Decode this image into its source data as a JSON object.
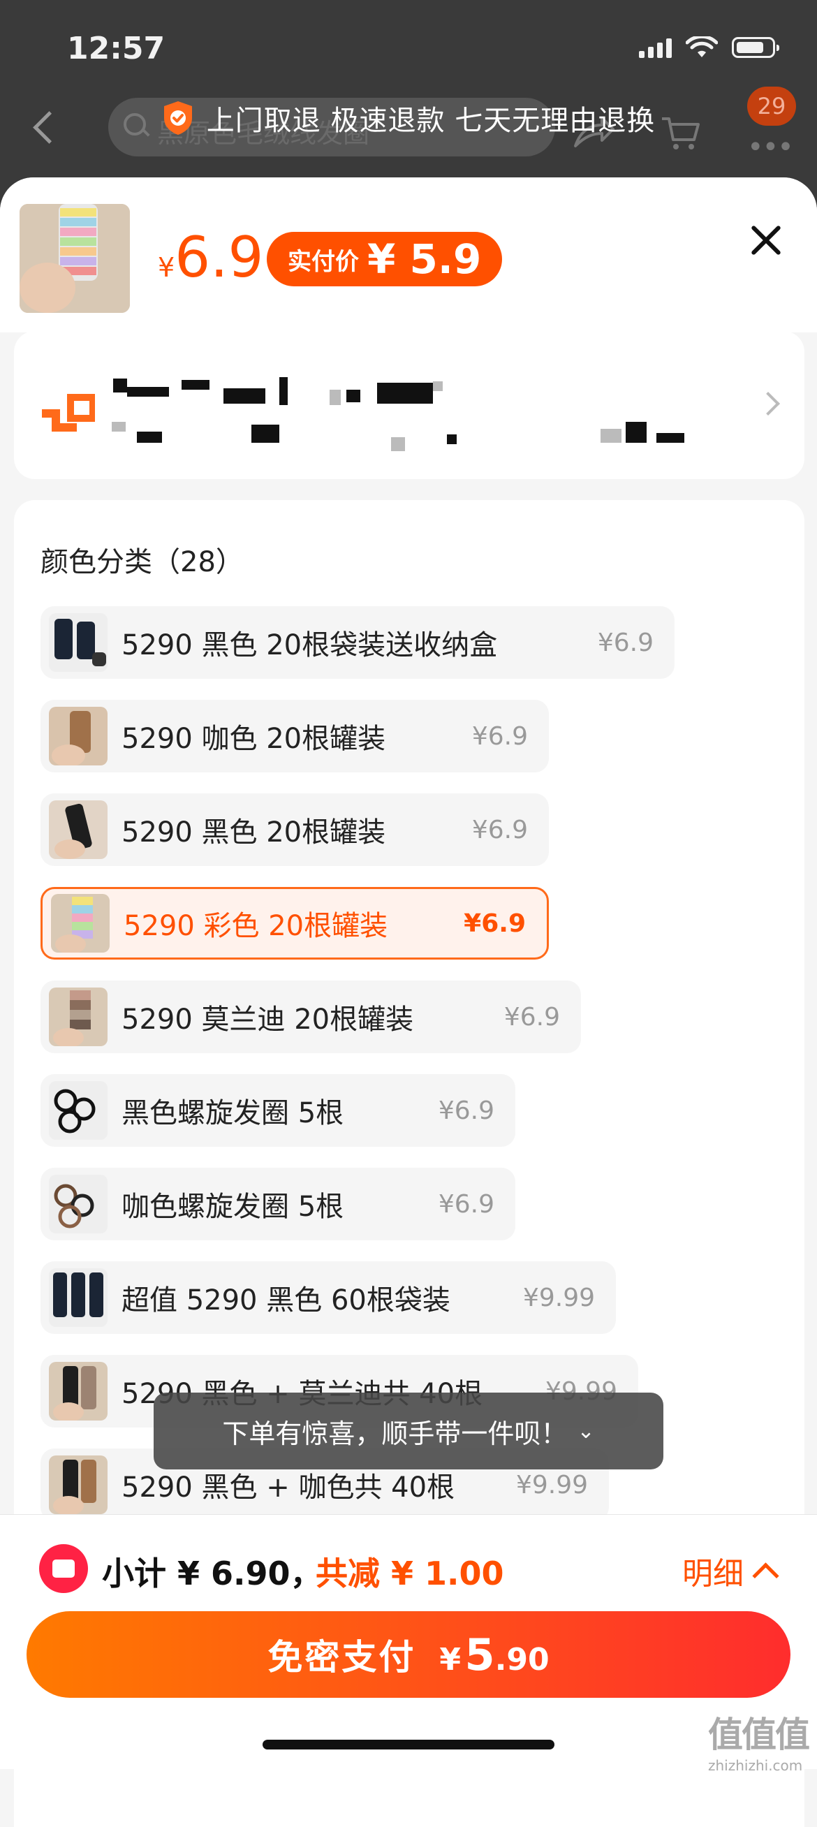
{
  "status": {
    "time": "12:57"
  },
  "nav": {
    "search_placeholder": "黑原色毛绒线发圈",
    "cart_badge": "29"
  },
  "banner": {
    "text": "上门取退 极速退款 七天无理由退换"
  },
  "header": {
    "currency": "¥",
    "price": "6.9",
    "pay_label": "实付价",
    "pay_price": "¥ 5.9"
  },
  "options": {
    "title": "颜色分类（28）",
    "items": [
      {
        "label": "5290 黑色 20根袋装送收纳盒",
        "price": "¥6.9",
        "selected": false
      },
      {
        "label": "5290 咖色 20根罐装",
        "price": "¥6.9",
        "selected": false
      },
      {
        "label": "5290 黑色 20根罐装",
        "price": "¥6.9",
        "selected": false
      },
      {
        "label": "5290 彩色 20根罐装",
        "price": "¥6.9",
        "selected": true
      },
      {
        "label": "5290 莫兰迪 20根罐装",
        "price": "¥6.9",
        "selected": false
      },
      {
        "label": "黑色螺旋发圈 5根",
        "price": "¥6.9",
        "selected": false
      },
      {
        "label": "咖色螺旋发圈 5根",
        "price": "¥6.9",
        "selected": false
      },
      {
        "label": "超值 5290 黑色 60根袋装",
        "price": "¥9.99",
        "selected": false
      },
      {
        "label": "5290 黑色 + 莫兰迪共 40根",
        "price": "¥9.99",
        "selected": false
      },
      {
        "label": "5290 黑色 + 咖色共 40根",
        "price": "¥9.99",
        "selected": false
      }
    ]
  },
  "toast": {
    "text": "下单有惊喜，顺手带一件呗！"
  },
  "footer": {
    "subtotal": "小计 ¥ 6.90，",
    "discount": "共减 ¥ 1.00",
    "detail_label": "明细",
    "pay_label": "免密支付",
    "pay_yen": "¥",
    "pay_int": "5",
    "pay_dec": ".90"
  },
  "watermark": {
    "glyphs": "值值值",
    "sub": "zhizhizhi.com"
  },
  "colors": {
    "accent": "#ff5000",
    "selected_bg": "#fff2ec",
    "pay_gradient_start": "#ff7a00",
    "pay_gradient_end": "#ff2d2d"
  }
}
